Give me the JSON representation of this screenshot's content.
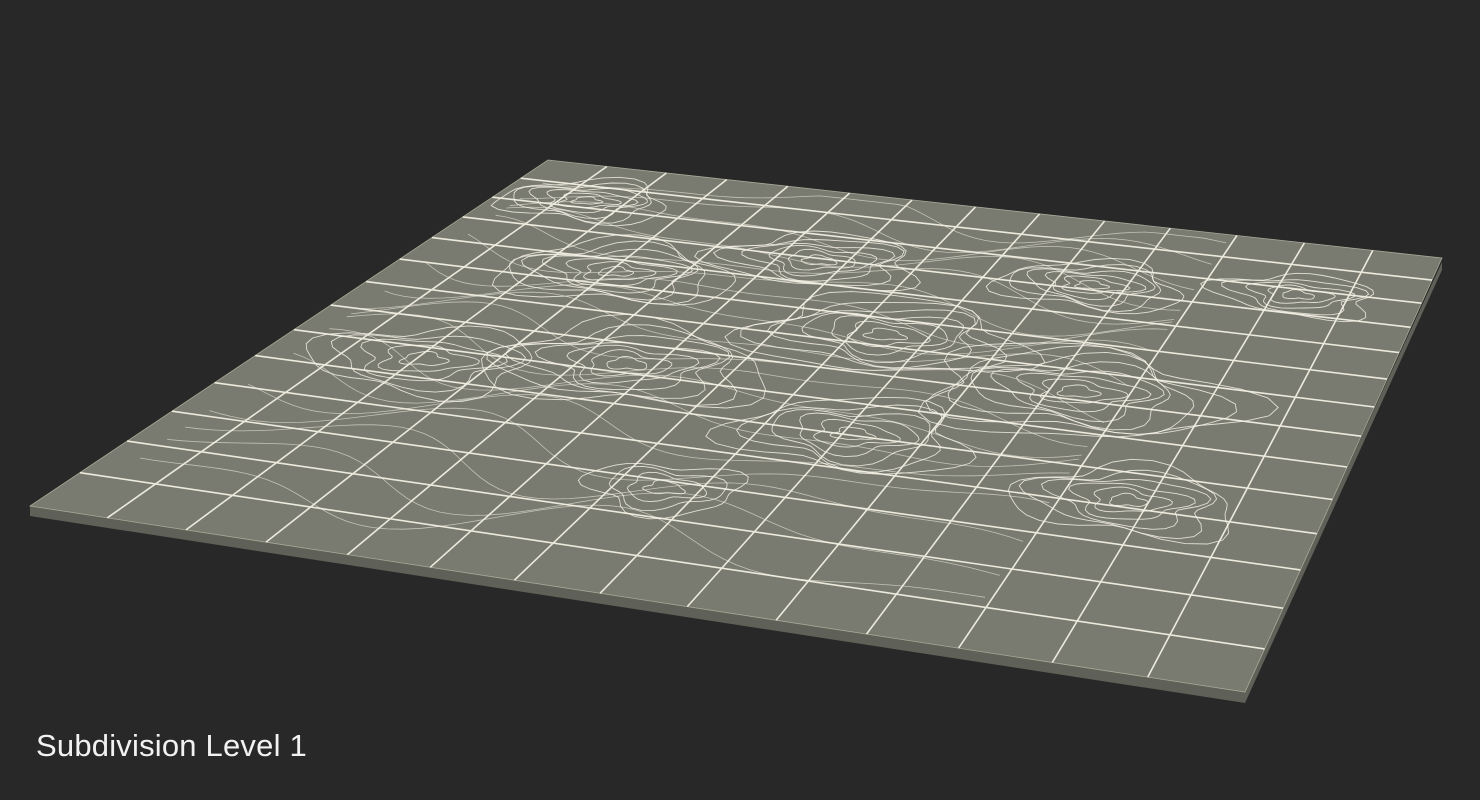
{
  "caption": "Subdivision Level 1",
  "colors": {
    "background": "#282828",
    "plane_top": "#7a7b70",
    "plane_edge": "#5f6057",
    "grid_lines": "#eceadc",
    "contour_lines": "#f4f1e6",
    "caption_text": "#f2f2f2"
  }
}
